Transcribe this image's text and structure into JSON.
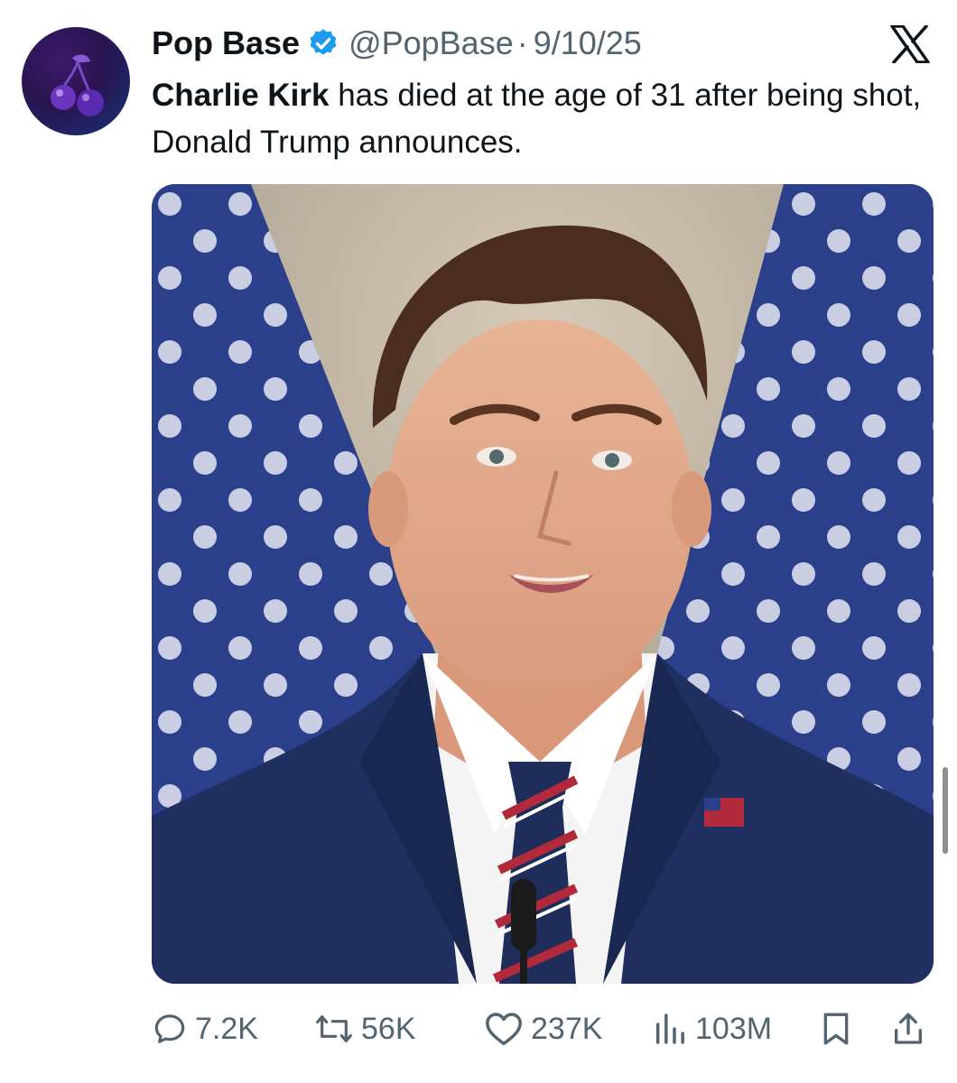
{
  "account": {
    "name": "Pop Base",
    "handle": "@PopBase",
    "separator": "·",
    "date": "9/10/25",
    "avatar_icon": "cherry-icon",
    "verified_icon": "verified-badge-icon",
    "verified_color": "#1d9bf0"
  },
  "platform_icon": "x-logo-icon",
  "tweet": {
    "text_bold": "Charlie Kirk",
    "text_rest": " has died at the age of 31 after being shot, Donald Trump announces."
  },
  "media": {
    "type": "photo",
    "subject": "man in navy suit with striped tie in front of American flags"
  },
  "actions": {
    "replies": {
      "icon": "reply-icon",
      "count": "7.2K"
    },
    "reposts": {
      "icon": "repost-icon",
      "count": "56K"
    },
    "likes": {
      "icon": "heart-icon",
      "count": "237K"
    },
    "views": {
      "icon": "views-chart-icon",
      "count": "103M"
    },
    "bookmark": {
      "icon": "bookmark-icon"
    },
    "share": {
      "icon": "share-icon"
    }
  },
  "colors": {
    "text_primary": "#0f1419",
    "text_secondary": "#536471"
  }
}
